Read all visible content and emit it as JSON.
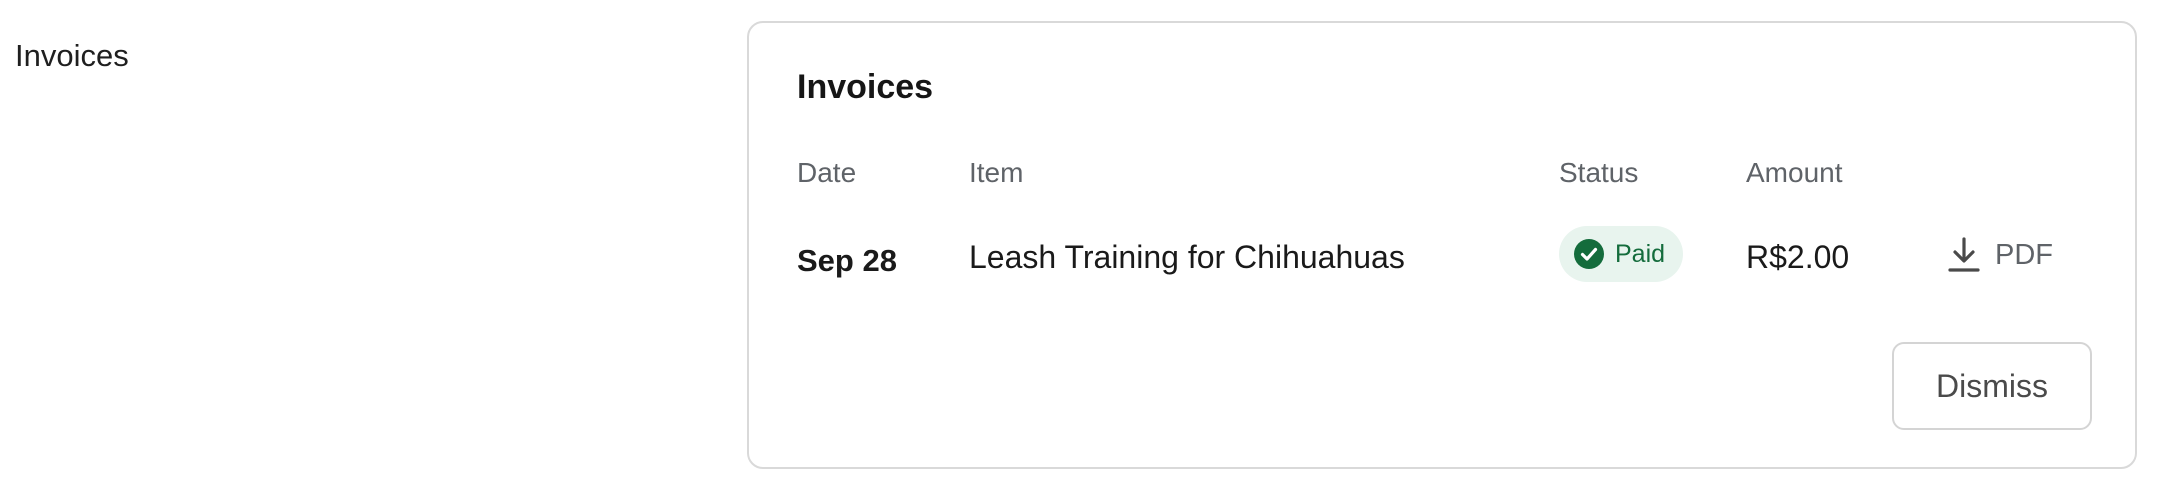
{
  "section": {
    "label": "Invoices"
  },
  "card": {
    "title": "Invoices",
    "columns": {
      "date": "Date",
      "item": "Item",
      "status": "Status",
      "amount": "Amount"
    },
    "rows": [
      {
        "date": "Sep 28",
        "item": "Leash Training for Chihuahuas",
        "status": "Paid",
        "amount": "R$2.00",
        "download_label": "PDF"
      }
    ],
    "dismiss_label": "Dismiss"
  },
  "icons": {
    "status": "check-circle-icon",
    "download": "download-icon"
  },
  "colors": {
    "paid_badge_bg": "#e8f4ee",
    "paid_green": "#146c3c",
    "muted_text": "#5f6368",
    "border": "#d9d9d9"
  }
}
